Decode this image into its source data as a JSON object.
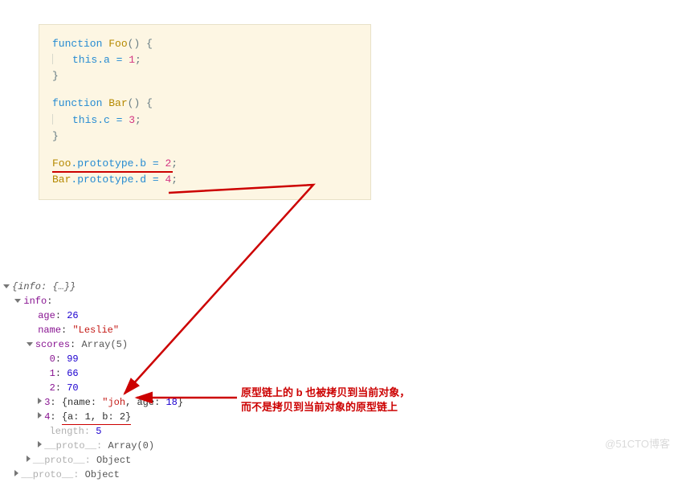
{
  "code": {
    "fn_kw": "function",
    "Foo": "Foo",
    "Bar": "Bar",
    "paren": "()",
    "brace_open": "{",
    "brace_close": "}",
    "this": "this",
    "dot_a_eq": ".a = ",
    "dot_c_eq": ".c = ",
    "one": "1",
    "three": "3",
    "semi": ";",
    "foo_proto": "Foo",
    "bar_proto": "Bar",
    "proto_seg": ".prototype.",
    "b": "b",
    "d": "d",
    "eq": " = ",
    "two": "2",
    "four": "4"
  },
  "console": {
    "root": "{info: {…}}",
    "info_key": "info",
    "age_key": "age",
    "age_val": "26",
    "name_key": "name",
    "name_val": "\"Leslie\"",
    "scores_key": "scores",
    "scores_type": "Array(5)",
    "idx0": "0",
    "v0": "99",
    "idx1": "1",
    "v1": "66",
    "idx2": "2",
    "v2": "70",
    "idx3": "3",
    "v3_pre": "{name: ",
    "v3_str": "\"joh",
    "v3_mid": ", age: ",
    "v3_age": "18",
    "v3_post": "}",
    "idx4": "4",
    "v4": "{a: 1, b: 2}",
    "length_key": "length",
    "length_val": "5",
    "proto_key": "__proto__",
    "proto_arr": "Array(0)",
    "proto_obj": "Object"
  },
  "annotation": {
    "line1_a": "原型链上的 ",
    "line1_b": "b",
    "line1_c": " 也被拷贝到当前对象，",
    "line2": "而不是拷贝到当前对象的原型链上"
  },
  "watermark": "@51CTO博客"
}
